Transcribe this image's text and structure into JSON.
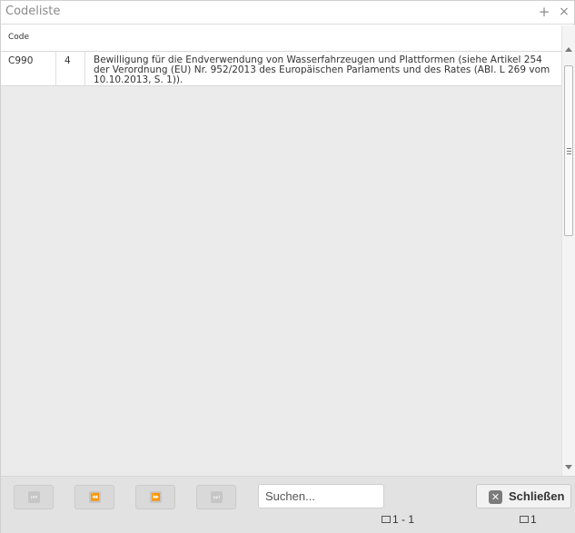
{
  "window": {
    "title": "Codeliste",
    "add_icon": "+",
    "close_icon": "×"
  },
  "grid": {
    "columns": [
      "Code"
    ],
    "rows": [
      {
        "code": "C990",
        "number": "4",
        "description": "Bewilligung für die Endverwendung von Wasserfahrzeugen und Plattformen (siehe Artikel 254 der Verordnung (EU) Nr. 952/2013 des Europäischen Parlaments und des Rates (ABl. L 269 vom 10.10.2013, S. 1))."
      }
    ]
  },
  "footer": {
    "nav_buttons": [
      {
        "name": "first-page",
        "icon": "first-page-icon",
        "glyph": "⏮"
      },
      {
        "name": "previous-page",
        "icon": "previous-page-icon",
        "glyph": "⏪"
      },
      {
        "name": "next-page",
        "icon": "next-page-icon",
        "glyph": "⏩"
      },
      {
        "name": "last-page",
        "icon": "last-page-icon",
        "glyph": "⏭"
      }
    ],
    "search_placeholder": "Suchen...",
    "search_value": "",
    "close_label": "Schließen",
    "close_icon": "✕",
    "range_text": "1 - 1",
    "count_text": "1"
  }
}
